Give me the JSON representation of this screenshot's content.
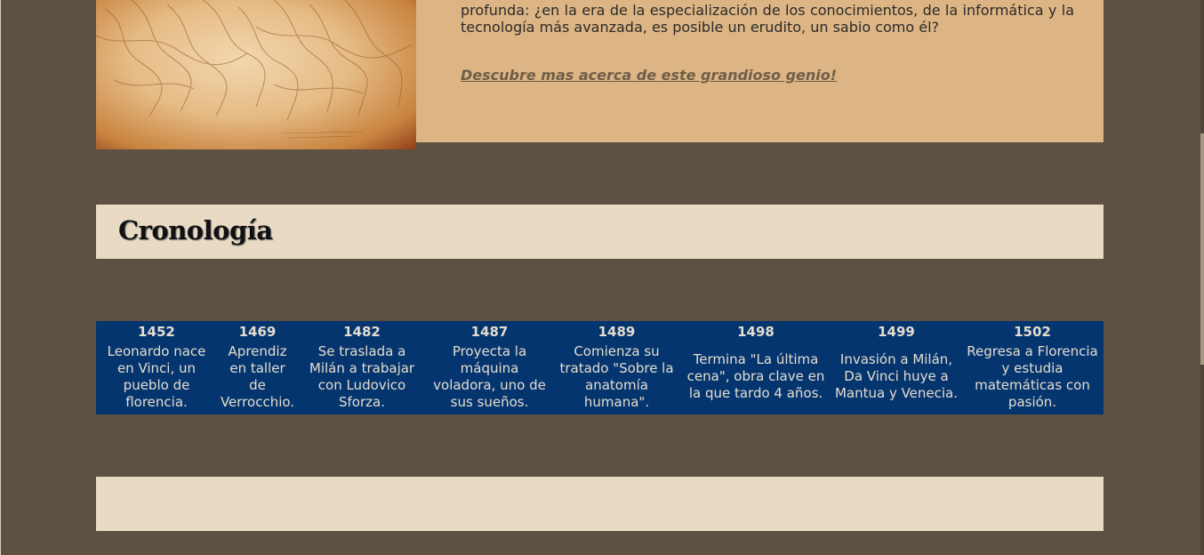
{
  "intro": {
    "text": "profunda: ¿en la era de la especialización de los conocimientos, de la informática y la tecnología más avanzada, es posible un erudito, un sabio como él?",
    "link": "Descubre mas acerca de este grandioso genio!"
  },
  "chronology": {
    "title": "Cronología"
  },
  "timeline": {
    "events": [
      {
        "year": "1452",
        "desc": "Leonardo nace en Vinci, un pueblo de florencia."
      },
      {
        "year": "1469",
        "desc": "Aprendiz en taller de Verrocchio."
      },
      {
        "year": "1482",
        "desc": "Se traslada a Milán a trabajar con Ludovico Sforza."
      },
      {
        "year": "1487",
        "desc": "Proyecta la máquina voladora, uno de sus sueños."
      },
      {
        "year": "1489",
        "desc": "Comienza su tratado \"Sobre la anatomía humana\"."
      },
      {
        "year": "1498",
        "desc": "Termina \"La última cena\", obra clave en la que tardo 4 años."
      },
      {
        "year": "1499",
        "desc": "Invasión a Milán, Da Vinci huye a Mantua y Venecia."
      },
      {
        "year": "1502",
        "desc": "Regresa a Florencia y estudia matemáticas con pasión."
      }
    ]
  },
  "colors": {
    "background": "#5c5142",
    "intro_card": "#ddb584",
    "section_bg": "#e9dac4",
    "timeline_bg": "#05356f",
    "timeline_text": "#e4dccd"
  }
}
